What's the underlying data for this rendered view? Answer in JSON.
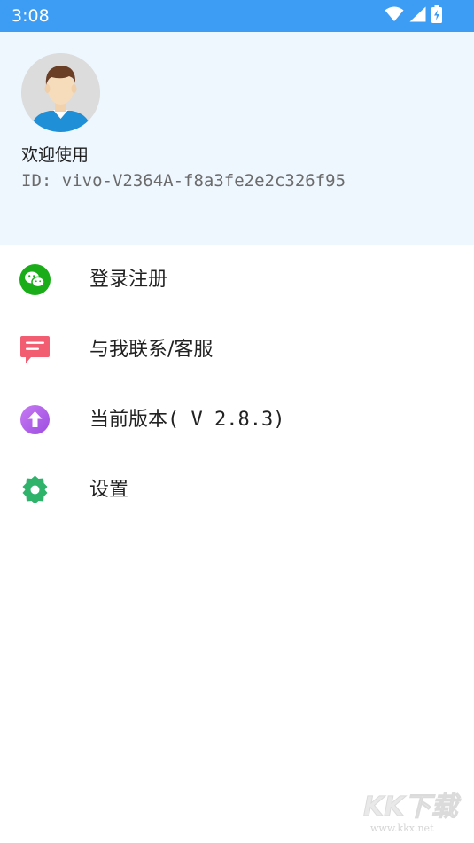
{
  "status_bar": {
    "time": "3:08",
    "icons": [
      "wifi-icon",
      "cellular-signal-icon",
      "battery-charging-icon"
    ],
    "color": "#3d9df4"
  },
  "profile": {
    "avatar": "default-man-avatar",
    "welcome": "欢迎使用",
    "user_id": "ID: vivo-V2364A-f8a3fe2e2c326f95",
    "background": "#eef6fe"
  },
  "menu": {
    "items": [
      {
        "label": "登录注册",
        "icon": "wechat-icon",
        "color": "#1aad19"
      },
      {
        "label": "与我联系/客服",
        "icon": "message-icon",
        "color": "#f25d72"
      },
      {
        "label": "当前版本( V 2.8.3)",
        "icon": "upgrade-arrow-icon",
        "color": "#a855e8"
      },
      {
        "label": "设置",
        "icon": "gear-icon",
        "color": "#2fb36b"
      }
    ]
  },
  "watermark": {
    "logo": "KK下载",
    "url": "www.kkx.net"
  }
}
